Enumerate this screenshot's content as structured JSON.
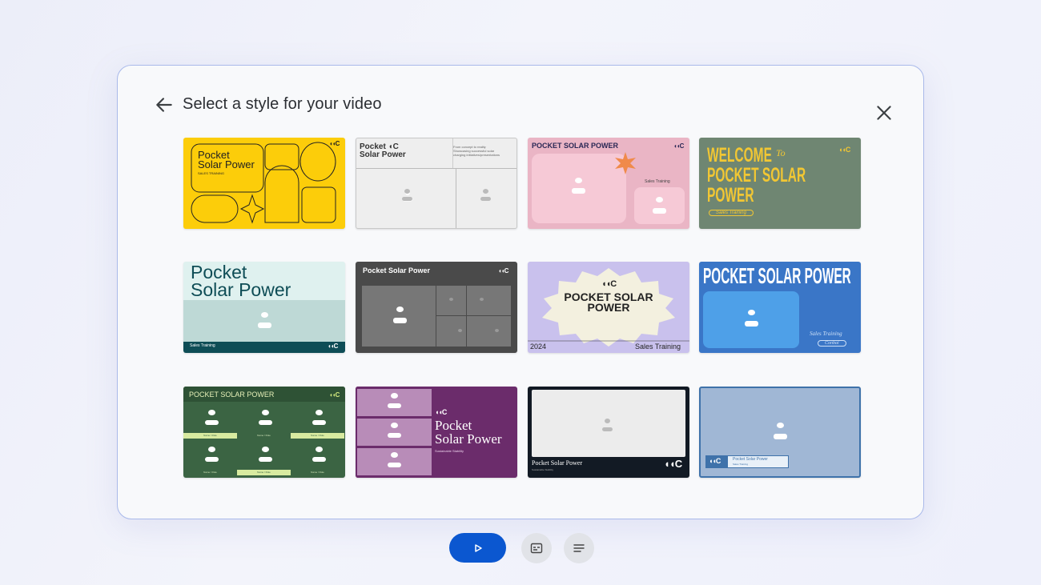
{
  "dialog": {
    "title": "Select a style for your video"
  },
  "logo": "◖◖C",
  "cards": {
    "c1": {
      "title": "Pocket\nSolar Power",
      "sub": "SALES TRAINING"
    },
    "c2": {
      "title": "Pocket ◖C\nSolar Power",
      "body": "From concept to reality\nShowcasing successful solar\ncharging initiatives/presentations"
    },
    "c3": {
      "title": "POCKET SOLAR POWER",
      "sub": "Sales Training"
    },
    "c4": {
      "l1": "WELCOME",
      "to": "To",
      "l2": "POCKET SOLAR",
      "l3": "POWER",
      "sub": "Sales Training"
    },
    "c5": {
      "title": "Pocket\nSolar Power",
      "foot": "Sales Training"
    },
    "c6": {
      "title": "Pocket Solar Power"
    },
    "c7": {
      "title": "POCKET SOLAR\nPOWER",
      "year": "2024",
      "sub": "Sales Training"
    },
    "c8": {
      "title": "POCKET SOLAR POWER",
      "sub": "Sales Training",
      "sub2": "Conbai"
    },
    "c9": {
      "title": "POCKET SOLAR POWER",
      "name": "Name / Role"
    },
    "c10": {
      "title": "Pocket\nSolar Power",
      "sub": "Sustainable Stability"
    },
    "c11": {
      "title": "Pocket Solar Power",
      "sub": "Sustainable Stability"
    },
    "c12": {
      "title": "Pocket Solar Power",
      "sub": "Sales Training"
    }
  },
  "colors": {
    "accent": "#0b57d0",
    "panel_border": "#a9b9ea"
  }
}
